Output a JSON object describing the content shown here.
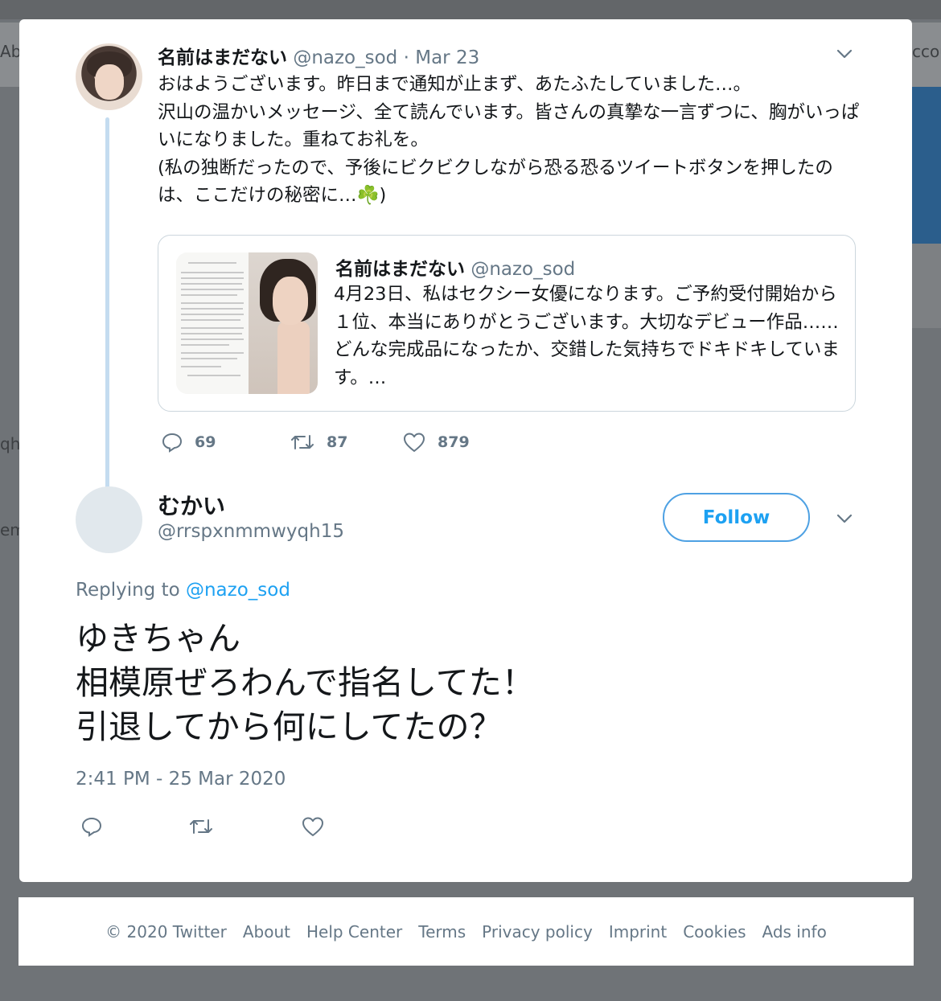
{
  "background": {
    "left_edge_texts": [
      "Abo",
      "qh",
      "em"
    ],
    "right_edge_text": "ccou"
  },
  "original_tweet": {
    "author_name": "名前はまだない",
    "author_handle": "@nazo_sod",
    "separator": "·",
    "date": "Mar 23",
    "body": "おはようございます。昨日まで通知が止まず、あたふたしていました…。\n沢山の温かいメッセージ、全て読んでいます。皆さんの真摯な一言ずつに、胸がいっぱいになりました。重ねてお礼を。\n(私の独断だったので、予後にビクビクしながら恐る恐るツイートボタンを押したのは、ここだけの秘密に…☘️)",
    "quoted": {
      "author_name": "名前はまだない",
      "author_handle": "@nazo_sod",
      "body": "4月23日、私はセクシー女優になります。ご予約受付開始から１位、本当にありがとうございます。大切なデビュー作品……どんな完成品になったか、交錯した気持ちでドキドキしています。…"
    },
    "stats": {
      "replies": "69",
      "retweets": "87",
      "likes": "879"
    }
  },
  "reply_tweet": {
    "author_name": "むかい",
    "author_handle": "@rrspxnmmwyqh15",
    "follow_label": "Follow",
    "replying_prefix": "Replying to",
    "replying_handle": "@nazo_sod",
    "body": "ゆきちゃん\n相模原ぜろわんで指名してた！\n引退してから何にしてたの？",
    "timestamp": "2:41 PM - 25 Mar 2020"
  },
  "footer": {
    "links": [
      "© 2020 Twitter",
      "About",
      "Help Center",
      "Terms",
      "Privacy policy",
      "Imprint",
      "Cookies",
      "Ads info"
    ]
  },
  "colors": {
    "accent": "#1da1f2",
    "muted": "#657786",
    "thread_line": "#c4dcf0"
  },
  "icons": [
    "chevron-down-icon",
    "reply-icon",
    "retweet-icon",
    "like-icon",
    "clover-emoji"
  ]
}
